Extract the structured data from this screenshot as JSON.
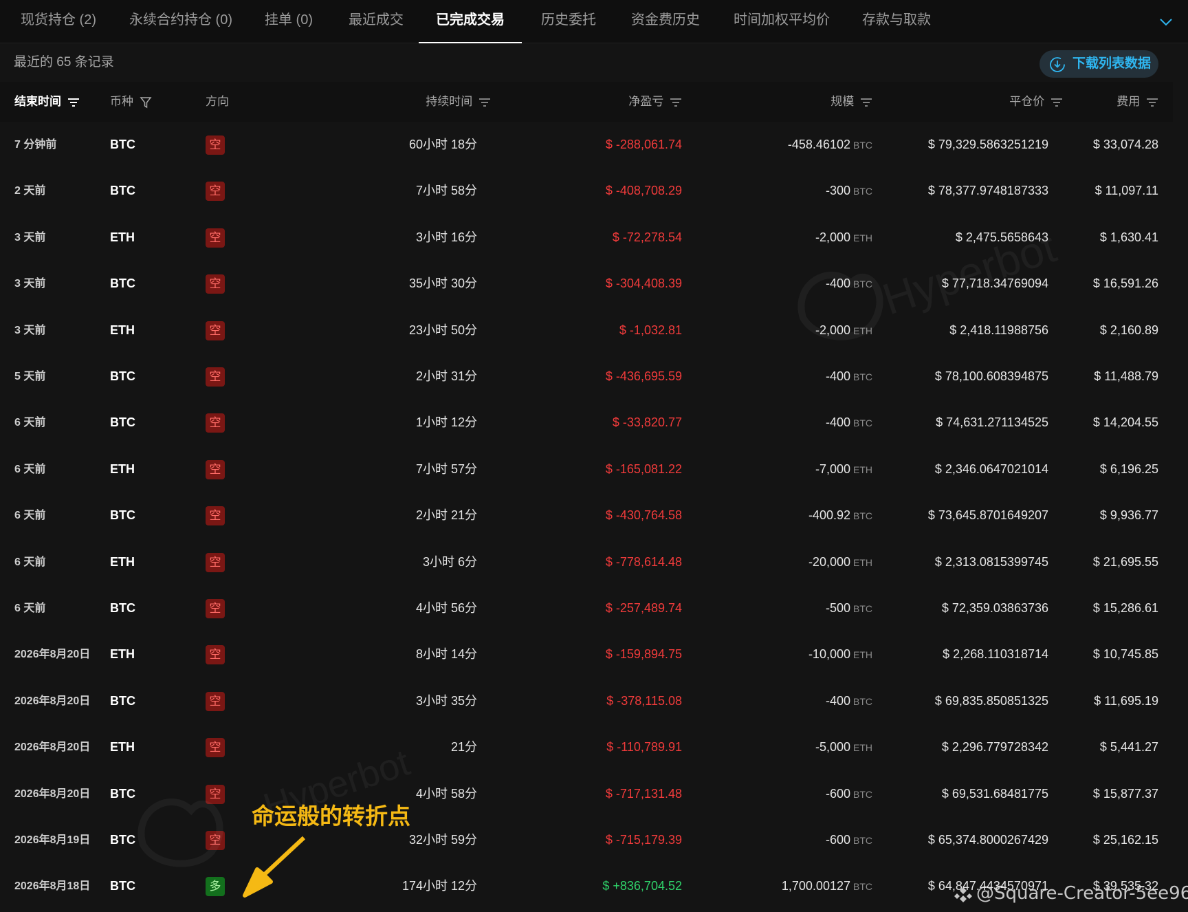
{
  "tabs": [
    {
      "label": "现货持仓 (2)"
    },
    {
      "label": "永续合约持仓 (0)"
    },
    {
      "label": "挂单 (0)"
    },
    {
      "label": "最近成交"
    },
    {
      "label": "已完成交易",
      "active": true
    },
    {
      "label": "历史委托"
    },
    {
      "label": "资金费历史"
    },
    {
      "label": "时间加权平均价"
    },
    {
      "label": "存款与取款"
    }
  ],
  "subbar": {
    "record_count": "最近的 65 条记录",
    "download_label": "下载列表数据"
  },
  "columns": {
    "time": "结束时间",
    "coin": "币种",
    "direction": "方向",
    "duration": "持续时间",
    "pnl": "净盈亏",
    "size": "规模",
    "close_price": "平仓价",
    "fee": "费用"
  },
  "rows": [
    {
      "time": "7 分钟前",
      "coin": "BTC",
      "dir": "空",
      "side": "short",
      "duration": "60小时 18分",
      "pnl": "$ -288,061.74",
      "pnl_sign": "neg",
      "size": "-458.46102",
      "unit": "BTC",
      "price": "$ 79,329.5863251219",
      "fee": "$ 33,074.28"
    },
    {
      "time": "2 天前",
      "coin": "BTC",
      "dir": "空",
      "side": "short",
      "duration": "7小时 58分",
      "pnl": "$ -408,708.29",
      "pnl_sign": "neg",
      "size": "-300",
      "unit": "BTC",
      "price": "$ 78,377.9748187333",
      "fee": "$ 11,097.11"
    },
    {
      "time": "3 天前",
      "coin": "ETH",
      "dir": "空",
      "side": "short",
      "duration": "3小时 16分",
      "pnl": "$ -72,278.54",
      "pnl_sign": "neg",
      "size": "-2,000",
      "unit": "ETH",
      "price": "$ 2,475.5658643",
      "fee": "$ 1,630.41"
    },
    {
      "time": "3 天前",
      "coin": "BTC",
      "dir": "空",
      "side": "short",
      "duration": "35小时 30分",
      "pnl": "$ -304,408.39",
      "pnl_sign": "neg",
      "size": "-400",
      "unit": "BTC",
      "price": "$ 77,718.34769094",
      "fee": "$ 16,591.26"
    },
    {
      "time": "3 天前",
      "coin": "ETH",
      "dir": "空",
      "side": "short",
      "duration": "23小时 50分",
      "pnl": "$ -1,032.81",
      "pnl_sign": "neg",
      "size": "-2,000",
      "unit": "ETH",
      "price": "$ 2,418.11988756",
      "fee": "$ 2,160.89"
    },
    {
      "time": "5 天前",
      "coin": "BTC",
      "dir": "空",
      "side": "short",
      "duration": "2小时 31分",
      "pnl": "$ -436,695.59",
      "pnl_sign": "neg",
      "size": "-400",
      "unit": "BTC",
      "price": "$ 78,100.608394875",
      "fee": "$ 11,488.79"
    },
    {
      "time": "6 天前",
      "coin": "BTC",
      "dir": "空",
      "side": "short",
      "duration": "1小时 12分",
      "pnl": "$ -33,820.77",
      "pnl_sign": "neg",
      "size": "-400",
      "unit": "BTC",
      "price": "$ 74,631.271134525",
      "fee": "$ 14,204.55"
    },
    {
      "time": "6 天前",
      "coin": "ETH",
      "dir": "空",
      "side": "short",
      "duration": "7小时 57分",
      "pnl": "$ -165,081.22",
      "pnl_sign": "neg",
      "size": "-7,000",
      "unit": "ETH",
      "price": "$ 2,346.0647021014",
      "fee": "$ 6,196.25"
    },
    {
      "time": "6 天前",
      "coin": "BTC",
      "dir": "空",
      "side": "short",
      "duration": "2小时 21分",
      "pnl": "$ -430,764.58",
      "pnl_sign": "neg",
      "size": "-400.92",
      "unit": "BTC",
      "price": "$ 73,645.8701649207",
      "fee": "$ 9,936.77"
    },
    {
      "time": "6 天前",
      "coin": "ETH",
      "dir": "空",
      "side": "short",
      "duration": "3小时 6分",
      "pnl": "$ -778,614.48",
      "pnl_sign": "neg",
      "size": "-20,000",
      "unit": "ETH",
      "price": "$ 2,313.0815399745",
      "fee": "$ 21,695.55"
    },
    {
      "time": "6 天前",
      "coin": "BTC",
      "dir": "空",
      "side": "short",
      "duration": "4小时 56分",
      "pnl": "$ -257,489.74",
      "pnl_sign": "neg",
      "size": "-500",
      "unit": "BTC",
      "price": "$ 72,359.03863736",
      "fee": "$ 15,286.61"
    },
    {
      "time": "2026年8月20日",
      "coin": "ETH",
      "dir": "空",
      "side": "short",
      "duration": "8小时 14分",
      "pnl": "$ -159,894.75",
      "pnl_sign": "neg",
      "size": "-10,000",
      "unit": "ETH",
      "price": "$ 2,268.110318714",
      "fee": "$ 10,745.85"
    },
    {
      "time": "2026年8月20日",
      "coin": "BTC",
      "dir": "空",
      "side": "short",
      "duration": "3小时 35分",
      "pnl": "$ -378,115.08",
      "pnl_sign": "neg",
      "size": "-400",
      "unit": "BTC",
      "price": "$ 69,835.850851325",
      "fee": "$ 11,695.19"
    },
    {
      "time": "2026年8月20日",
      "coin": "ETH",
      "dir": "空",
      "side": "short",
      "duration": "21分",
      "pnl": "$ -110,789.91",
      "pnl_sign": "neg",
      "size": "-5,000",
      "unit": "ETH",
      "price": "$ 2,296.779728342",
      "fee": "$ 5,441.27"
    },
    {
      "time": "2026年8月20日",
      "coin": "BTC",
      "dir": "空",
      "side": "short",
      "duration": "4小时 58分",
      "pnl": "$ -717,131.48",
      "pnl_sign": "neg",
      "size": "-600",
      "unit": "BTC",
      "price": "$ 69,531.68481775",
      "fee": "$ 15,877.37"
    },
    {
      "time": "2026年8月19日",
      "coin": "BTC",
      "dir": "空",
      "side": "short",
      "duration": "32小时 59分",
      "pnl": "$ -715,179.39",
      "pnl_sign": "neg",
      "size": "-600",
      "unit": "BTC",
      "price": "$ 65,374.8000267429",
      "fee": "$ 25,162.15"
    },
    {
      "time": "2026年8月18日",
      "coin": "BTC",
      "dir": "多",
      "side": "long",
      "duration": "174小时 12分",
      "pnl": "$ +836,704.52",
      "pnl_sign": "pos",
      "size": "1,700.00127",
      "unit": "BTC",
      "price": "$ 64,847.4434570971",
      "fee": "$ 39,535.32"
    }
  ],
  "watermark": "Hyperbot",
  "annotation": "命运般的转折点",
  "credit": "@Square-Creator-5ee96...",
  "colors": {
    "background": "#141414",
    "loss": "#f23b3b",
    "gain": "#2fd36a",
    "short_badge": "#7a1714",
    "long_badge": "#13701d",
    "accent": "#2fb6f0",
    "annotation": "#f5b914"
  }
}
